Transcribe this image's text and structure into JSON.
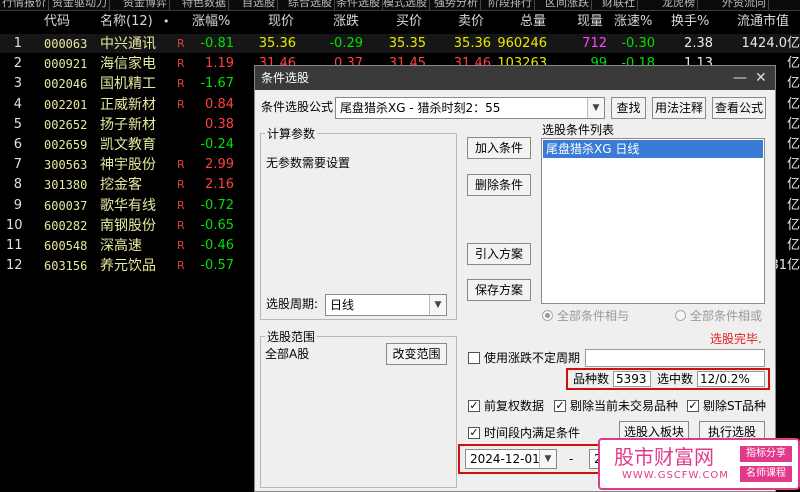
{
  "top_tabs": [
    "行情报价",
    "资金驱动力",
    "资金博弈",
    "特色数据",
    "自选股",
    "综合选股",
    "条件选股",
    "模式选股",
    "强势分析",
    "阶段排行",
    "区间涨跌",
    "财联社",
    "龙虎榜",
    "外资流向"
  ],
  "columns": [
    "代码",
    "名称(12)",
    "•",
    "涨幅%",
    "现价",
    "涨跌",
    "买价",
    "卖价",
    "总量",
    "现量",
    "涨速%",
    "换手%",
    "流通市值"
  ],
  "rows": [
    {
      "idx": "1",
      "code": "000063",
      "name": "中兴通讯",
      "r": "R",
      "chg_pct": "-0.81",
      "price": "35.36",
      "chg": "-0.29",
      "bid": "35.35",
      "ask": "35.36",
      "vol": "960246",
      "cur_vol": "712",
      "speed": "-0.30",
      "turnover": "2.38",
      "cap": "1424.0亿"
    },
    {
      "idx": "2",
      "code": "000921",
      "name": "海信家电",
      "r": "R",
      "chg_pct": "1.19",
      "price": "31.46",
      "chg": "0.37",
      "bid": "31.45",
      "ask": "31.46",
      "vol": "103263",
      "cur_vol": "99",
      "speed": "-0.18",
      "turnover": "1.13",
      "cap": "亿"
    },
    {
      "idx": "3",
      "code": "002046",
      "name": "国机精工",
      "r": "R",
      "chg_pct": "-1.67",
      "cap": "亿"
    },
    {
      "idx": "4",
      "code": "002201",
      "name": "正威新材",
      "r": "R",
      "chg_pct": "0.84",
      "cap": "亿"
    },
    {
      "idx": "5",
      "code": "002652",
      "name": "扬子新材",
      "r": "",
      "chg_pct": "0.38",
      "cap": "亿"
    },
    {
      "idx": "6",
      "code": "002659",
      "name": "凯文教育",
      "r": "",
      "chg_pct": "-0.24",
      "cap": "亿"
    },
    {
      "idx": "7",
      "code": "300563",
      "name": "神宇股份",
      "r": "R",
      "chg_pct": "2.99",
      "cap": "亿"
    },
    {
      "idx": "8",
      "code": "301380",
      "name": "挖金客",
      "r": "R",
      "chg_pct": "2.16",
      "cap": "亿"
    },
    {
      "idx": "9",
      "code": "600037",
      "name": "歌华有线",
      "r": "R",
      "chg_pct": "-0.72",
      "cap": "亿"
    },
    {
      "idx": "10",
      "code": "600282",
      "name": "南钢股份",
      "r": "R",
      "chg_pct": "-0.65",
      "cap": "亿"
    },
    {
      "idx": "11",
      "code": "600548",
      "name": "深高速",
      "r": "R",
      "chg_pct": "-0.46",
      "cap": "亿"
    },
    {
      "idx": "12",
      "code": "603156",
      "name": "养元饮品",
      "r": "R",
      "chg_pct": "-0.57",
      "cap": "81亿"
    }
  ],
  "dialog": {
    "title": "条件选股",
    "formula_label": "条件选股公式",
    "formula_value": "尾盘猎杀XG  -  猎杀时刻2：55",
    "find_btn": "查找",
    "usage_btn": "用法注释",
    "view_btn": "查看公式",
    "params_group": "计算参数",
    "params_text": "无参数需要设置",
    "add_btn": "加入条件",
    "del_btn": "删除条件",
    "import_btn": "引入方案",
    "save_btn": "保存方案",
    "list_group": "选股条件列表",
    "list_items": [
      "尾盘猎杀XG  日线"
    ],
    "period_label": "选股周期:",
    "period_value": "日线",
    "radio_and": "全部条件相与",
    "radio_or": "全部条件相或",
    "status": "选股完毕.",
    "range_group": "选股范围",
    "range_value": "全部A股",
    "change_range_btn": "改变范围",
    "use_period_label": "使用涨跌不定周期",
    "species_label": "品种数",
    "species_value": "5393",
    "selected_label": "选中数",
    "selected_value": "12/0.2%",
    "chk_fq": "前复权数据",
    "chk_rm_untraded": "剔除当前未交易品种",
    "chk_rm_st": "剔除ST品种",
    "chk_period": "时间段内满足条件",
    "to_board_btn": "选股入板块",
    "run_btn": "执行选股",
    "date_from": "2024-12-01",
    "date_sep": "-",
    "date_to": "20"
  },
  "watermark": {
    "title": "股市财富网",
    "url": "WWW.GSCFW.COM",
    "tag1": "指标分享",
    "tag2": "名师课程"
  },
  "colors": {
    "up": "#ff4040",
    "down": "#00e000",
    "dialog_title": "#3a3a3a",
    "highlight": "#3a7bd5",
    "red_box": "#d01010"
  }
}
